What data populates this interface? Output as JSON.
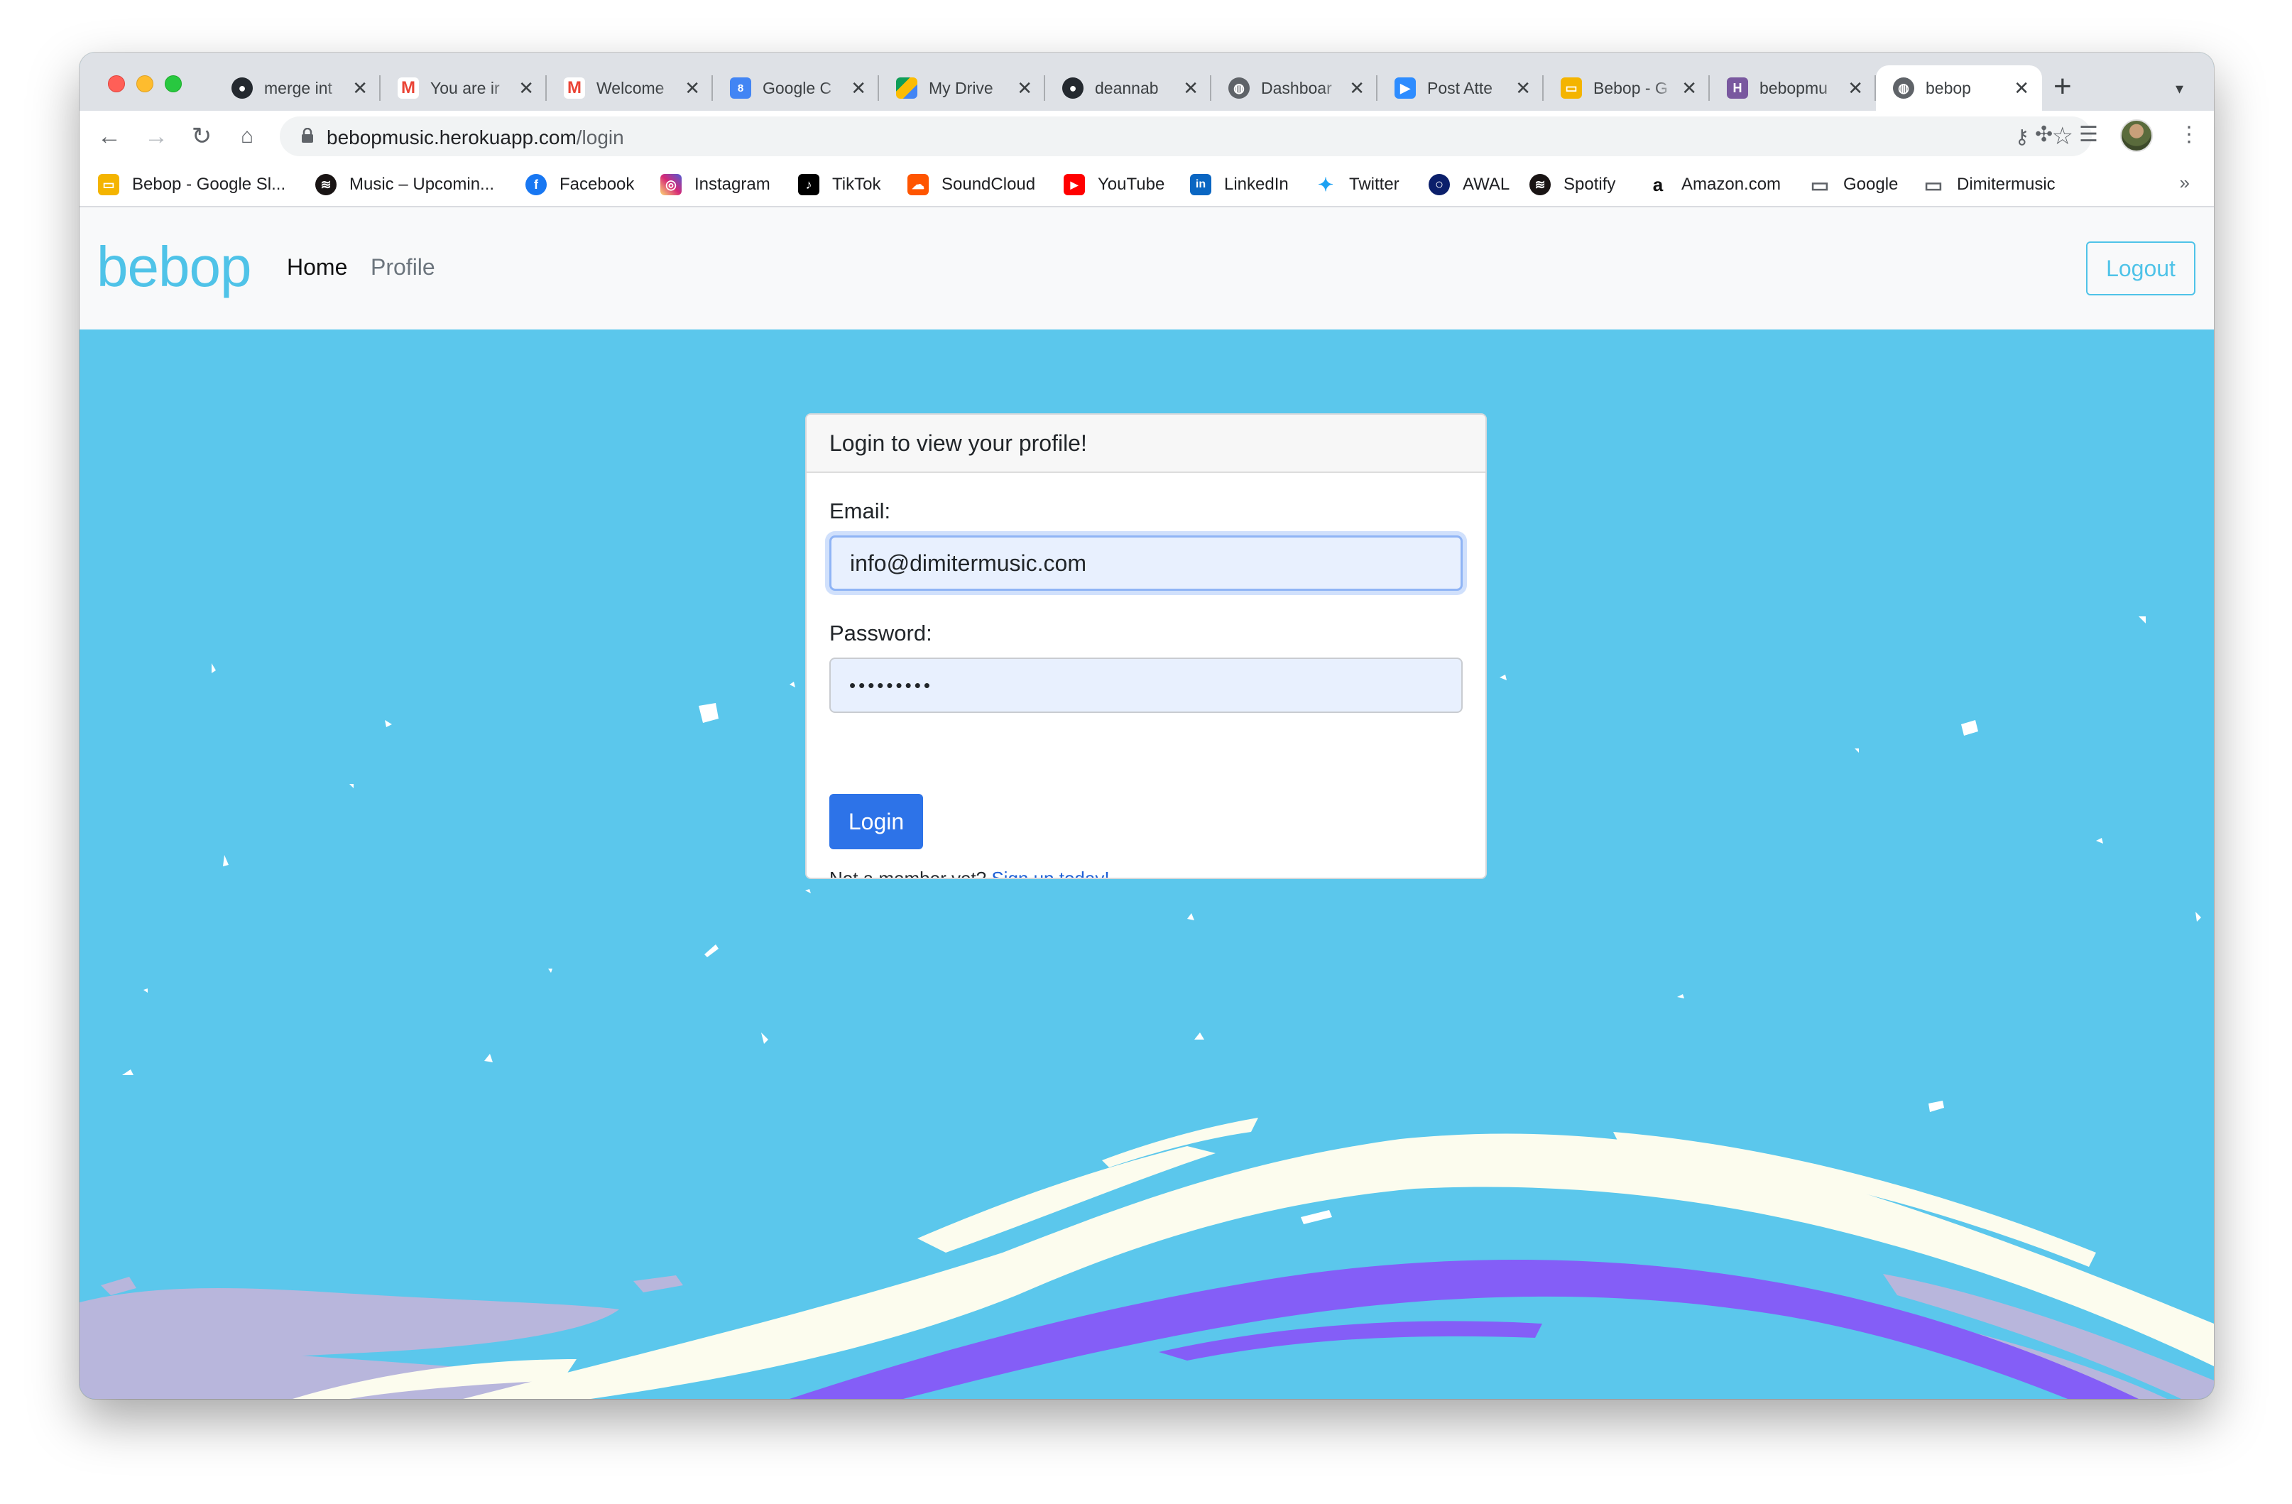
{
  "browser": {
    "tabs": [
      {
        "title": "merge int",
        "icon": "github-icon",
        "active": false
      },
      {
        "title": "You are ir",
        "icon": "gmail-icon",
        "active": false
      },
      {
        "title": "Welcome",
        "icon": "gmail-icon",
        "active": false
      },
      {
        "title": "Google C",
        "icon": "google-calendar-icon",
        "active": false
      },
      {
        "title": "My Drive",
        "icon": "google-drive-icon",
        "active": false
      },
      {
        "title": "deannab",
        "icon": "github-icon",
        "active": false
      },
      {
        "title": "Dashboar",
        "icon": "globe-icon",
        "active": false
      },
      {
        "title": "Post Atte",
        "icon": "zoom-icon",
        "active": false
      },
      {
        "title": "Bebop - G",
        "icon": "google-slides-icon",
        "active": false
      },
      {
        "title": "bebopmu",
        "icon": "heroku-icon",
        "active": false
      },
      {
        "title": "bebop",
        "icon": "globe-icon",
        "active": true
      }
    ],
    "tab_close_glyph": "✕",
    "new_tab_glyph": "+",
    "url_domain": "bebopmusic.herokuapp.com",
    "url_path": "/login",
    "bookmarks": [
      {
        "label": "Bebop - Google Sl...",
        "icon": "google-slides-icon"
      },
      {
        "label": "Music – Upcomin...",
        "icon": "spotify-icon"
      },
      {
        "label": "Facebook",
        "icon": "facebook-icon"
      },
      {
        "label": "Instagram",
        "icon": "instagram-icon"
      },
      {
        "label": "TikTok",
        "icon": "tiktok-icon"
      },
      {
        "label": "SoundCloud",
        "icon": "soundcloud-icon"
      },
      {
        "label": "YouTube",
        "icon": "youtube-icon"
      },
      {
        "label": "LinkedIn",
        "icon": "linkedin-icon"
      },
      {
        "label": "Twitter",
        "icon": "twitter-icon"
      },
      {
        "label": "AWAL",
        "icon": "awal-icon"
      },
      {
        "label": "Spotify",
        "icon": "spotify-icon"
      },
      {
        "label": "Amazon.com",
        "icon": "amazon-icon"
      },
      {
        "label": "Google",
        "icon": "folder-icon"
      },
      {
        "label": "Dimitermusic",
        "icon": "folder-icon"
      }
    ],
    "bookmarks_overflow": "»"
  },
  "site": {
    "brand": "bebop",
    "nav": {
      "home": "Home",
      "profile": "Profile"
    },
    "logout": "Logout"
  },
  "login": {
    "header": "Login to view your profile!",
    "email_label": "Email:",
    "email_value": "info@dimitermusic.com",
    "password_label": "Password:",
    "password_value": "•••••••••",
    "submit": "Login",
    "signup_prompt": "Not a member yet?",
    "signup_link": "Sign up today!"
  },
  "colors": {
    "brand": "#4fc3e8",
    "page_background": "#5bc7ec",
    "primary_button": "#2d73e8",
    "link": "#1d5fd6",
    "swoosh_cream": "#fcfcee",
    "swoosh_purple": "#845ef7",
    "swoosh_lavender": "#b8b6dc"
  }
}
